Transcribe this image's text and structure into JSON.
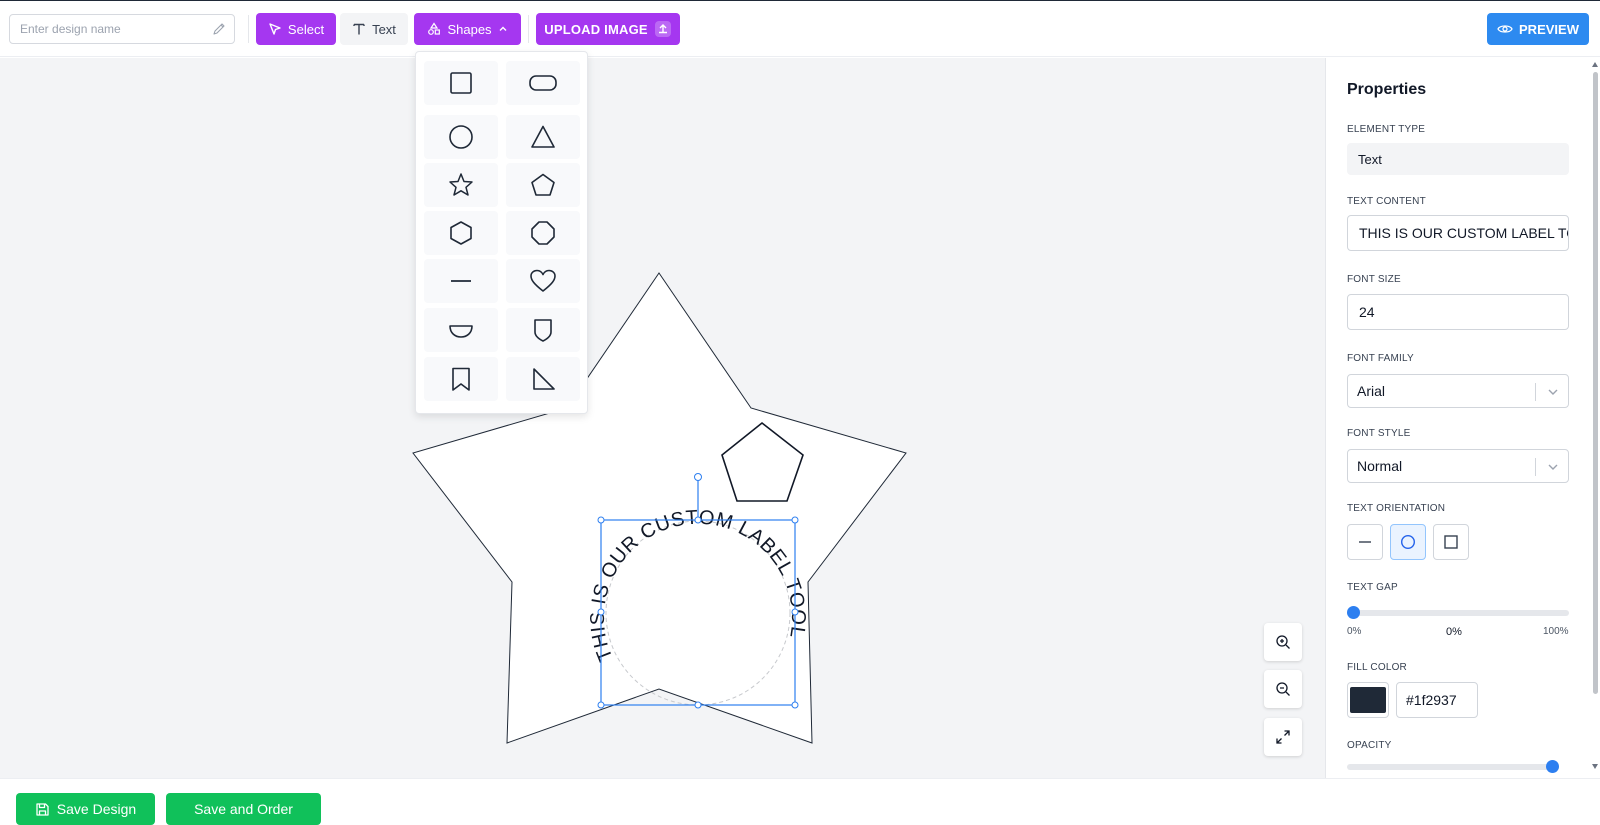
{
  "toolbar": {
    "design_name_placeholder": "Enter design name",
    "select_label": "Select",
    "text_label": "Text",
    "shapes_label": "Shapes",
    "upload_label": "UPLOAD IMAGE",
    "preview_label": "PREVIEW",
    "accent_color": "#a537f0",
    "preview_color": "#2d8af0"
  },
  "shapes_menu": {
    "items": [
      "square-icon",
      "pill-icon",
      "circle-icon",
      "triangle-icon",
      "star-icon",
      "pentagon-icon",
      "hexagon-icon",
      "octagon-icon",
      "line-icon",
      "heart-icon",
      "half-circle-icon",
      "shield-icon",
      "bookmark-icon",
      "right-triangle-icon"
    ]
  },
  "canvas": {
    "curved_text": "THIS IS OUR CUSTOM LABEL TOOL",
    "background_color": "#f3f4f6"
  },
  "properties": {
    "title": "Properties",
    "element_type_label": "ELEMENT TYPE",
    "element_type_value": "Text",
    "text_content_label": "TEXT CONTENT",
    "text_content_value": "THIS IS OUR CUSTOM LABEL TOOL",
    "font_size_label": "FONT SIZE",
    "font_size_value": "24",
    "font_family_label": "FONT FAMILY",
    "font_family_value": "Arial",
    "font_style_label": "FONT STYLE",
    "font_style_value": "Normal",
    "text_orientation_label": "TEXT ORIENTATION",
    "text_orientation_selected": "circle",
    "text_gap_label": "TEXT GAP",
    "text_gap_min": "0%",
    "text_gap_value": "0%",
    "text_gap_max": "100%",
    "text_gap_fraction": 0,
    "fill_color_label": "FILL COLOR",
    "fill_color_value": "#1f2937",
    "opacity_label": "OPACITY",
    "opacity_fraction": 1
  },
  "footer": {
    "save_design_label": "Save Design",
    "save_order_label": "Save and Order",
    "button_color": "#10c15a"
  }
}
